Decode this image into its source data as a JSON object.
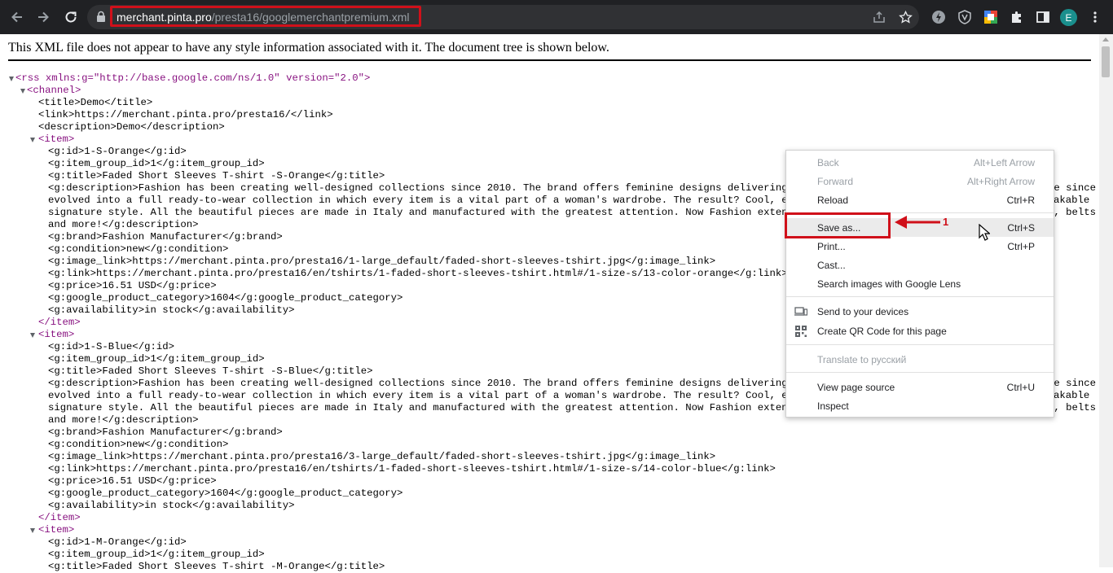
{
  "browser": {
    "url_host": "merchant.pinta.pro",
    "url_path": "/presta16/googlemerchantpremium.xml",
    "avatar_letter": "E",
    "annotation_color": "#d0101a"
  },
  "page": {
    "banner": "This XML file does not appear to have any style information associated with it. The document tree is shown below."
  },
  "xml": {
    "rss_open": "<rss xmlns:g=\"http://base.google.com/ns/1.0\" version=\"2.0\">",
    "channel_open": "<channel>",
    "title": "<title>Demo</title>",
    "link": "<link>https://merchant.pinta.pro/presta16/</link>",
    "description": "<description>Demo</description>",
    "item_open": "<item>",
    "item_close": "</item>",
    "items": [
      {
        "id": "<g:id>1-S-Orange</g:id>",
        "group": "<g:item_group_id>1</g:item_group_id>",
        "title": "<g:title>Faded Short Sleeves T-shirt -S-Orange</g:title>",
        "desc1": "<g:description>Fashion has been creating well-designed collections since 2010. The brand offers feminine designs delivering sty",
        "desc1_tail": "ve since",
        "desc2": "evolved into a full ready-to-wear collection in which every item is a vital part of a woman's wardrobe. The result? Cool, easy,",
        "desc2_tail": "akable",
        "desc3": "signature style. All the beautiful pieces are made in Italy and manufactured with the greatest attention. Now Fashion extends t",
        "desc3_tail": "s, belts",
        "desc4": "and more!</g:description>",
        "brand": "<g:brand>Fashion Manufacturer</g:brand>",
        "condition": "<g:condition>new</g:condition>",
        "image_link": "<g:image_link>https://merchant.pinta.pro/presta16/1-large_default/faded-short-sleeves-tshirt.jpg</g:image_link>",
        "link": "<g:link>https://merchant.pinta.pro/presta16/en/tshirts/1-faded-short-sleeves-tshirt.html#/1-size-s/13-color-orange</g:link>",
        "price": "<g:price>16.51 USD</g:price>",
        "category": "<g:google_product_category>1604</g:google_product_category>",
        "availability": "<g:availability>in stock</g:availability>"
      },
      {
        "id": "<g:id>1-S-Blue</g:id>",
        "group": "<g:item_group_id>1</g:item_group_id>",
        "title": "<g:title>Faded Short Sleeves T-shirt -S-Blue</g:title>",
        "desc1": "<g:description>Fashion has been creating well-designed collections since 2010. The brand offers feminine designs delivering sty",
        "desc1_tail": "ve since",
        "desc2": "evolved into a full ready-to-wear collection in which every item is a vital part of a woman's wardrobe. The result? Cool, easy,",
        "desc2_tail": "akable",
        "desc3": "signature style. All the beautiful pieces are made in Italy and manufactured with the greatest attention. Now Fashion extends t",
        "desc3_tail": "s, belts",
        "desc4": "and more!</g:description>",
        "brand": "<g:brand>Fashion Manufacturer</g:brand>",
        "condition": "<g:condition>new</g:condition>",
        "image_link": "<g:image_link>https://merchant.pinta.pro/presta16/3-large_default/faded-short-sleeves-tshirt.jpg</g:image_link>",
        "link": "<g:link>https://merchant.pinta.pro/presta16/en/tshirts/1-faded-short-sleeves-tshirt.html#/1-size-s/14-color-blue</g:link>",
        "price": "<g:price>16.51 USD</g:price>",
        "category": "<g:google_product_category>1604</g:google_product_category>",
        "availability": "<g:availability>in stock</g:availability>"
      },
      {
        "id": "<g:id>1-M-Orange</g:id>",
        "group": "<g:item_group_id>1</g:item_group_id>",
        "title": "<g:title>Faded Short Sleeves T-shirt -M-Orange</g:title>"
      }
    ]
  },
  "context_menu": {
    "back": "Back",
    "back_sc": "Alt+Left Arrow",
    "forward": "Forward",
    "forward_sc": "Alt+Right Arrow",
    "reload": "Reload",
    "reload_sc": "Ctrl+R",
    "save_as": "Save as...",
    "save_as_sc": "Ctrl+S",
    "print": "Print...",
    "print_sc": "Ctrl+P",
    "cast": "Cast...",
    "search_lens": "Search images with Google Lens",
    "send_devices": "Send to your devices",
    "qr_code": "Create QR Code for this page",
    "translate": "Translate to русский",
    "view_source": "View page source",
    "view_source_sc": "Ctrl+U",
    "inspect": "Inspect"
  },
  "annotation": {
    "step_number": "1"
  }
}
